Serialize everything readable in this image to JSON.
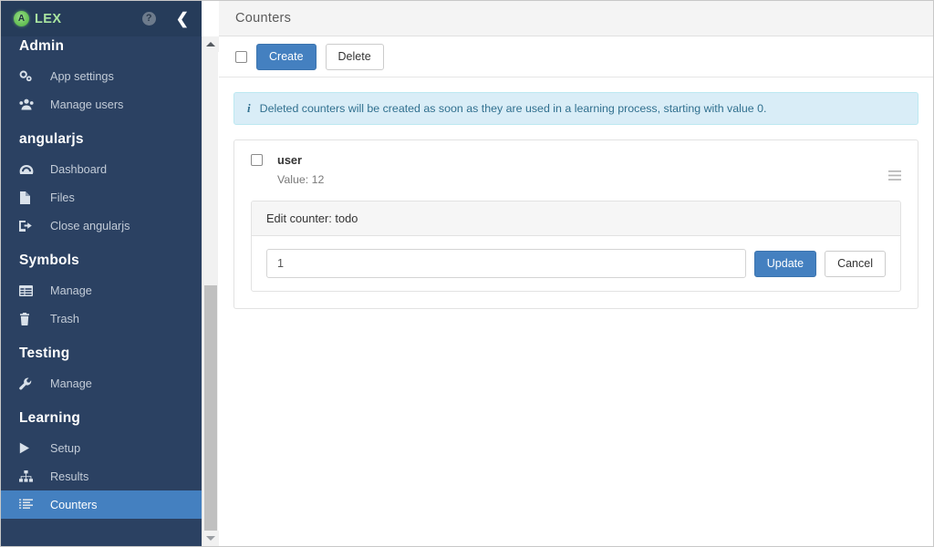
{
  "brand": {
    "mark_letter": "A",
    "name": "LEX",
    "help_icon": "question-circle-icon",
    "collapse_icon": "chevron-left-icon"
  },
  "sidebar": {
    "groups": [
      {
        "title": "Admin",
        "items": [
          {
            "label": "App settings",
            "icon": "gears-icon",
            "active": false
          },
          {
            "label": "Manage users",
            "icon": "users-icon",
            "active": false
          }
        ]
      },
      {
        "title": "angularjs",
        "items": [
          {
            "label": "Dashboard",
            "icon": "dashboard-icon",
            "active": false
          },
          {
            "label": "Files",
            "icon": "file-icon",
            "active": false
          },
          {
            "label": "Close angularjs",
            "icon": "sign-out-icon",
            "active": false
          }
        ]
      },
      {
        "title": "Symbols",
        "items": [
          {
            "label": "Manage",
            "icon": "table-icon",
            "active": false
          },
          {
            "label": "Trash",
            "icon": "trash-icon",
            "active": false
          }
        ]
      },
      {
        "title": "Testing",
        "items": [
          {
            "label": "Manage",
            "icon": "wrench-icon",
            "active": false
          }
        ]
      },
      {
        "title": "Learning",
        "items": [
          {
            "label": "Setup",
            "icon": "play-icon",
            "active": false
          },
          {
            "label": "Results",
            "icon": "sitemap-icon",
            "active": false
          },
          {
            "label": "Counters",
            "icon": "list-ol-icon",
            "active": true
          }
        ]
      }
    ],
    "scrollbar": {
      "up_arrow_icon": "caret-up-icon",
      "down_arrow_icon": "caret-down-icon"
    }
  },
  "header": {
    "title": "Counters"
  },
  "action_bar": {
    "select_all_checkbox": "select-all",
    "create_label": "Create",
    "delete_label": "Delete"
  },
  "alert": {
    "icon": "info-icon",
    "text": "Deleted counters will be created as soon as they are used in a learning process, starting with value 0."
  },
  "counters": [
    {
      "name": "user",
      "value_label": "Value: 12",
      "menu_icon": "hamburger-menu-icon"
    }
  ],
  "edit_form": {
    "title": "Edit counter: todo",
    "value": "1",
    "placeholder": "",
    "update_label": "Update",
    "cancel_label": "Cancel"
  },
  "colors": {
    "sidebar_bg": "#2b4162",
    "sidebar_brandbar_bg": "#263c5a",
    "accent_blue": "#4480c0",
    "brand_green": "#a9e5a0",
    "alert_bg": "#d9edf7",
    "alert_text": "#31708f"
  }
}
